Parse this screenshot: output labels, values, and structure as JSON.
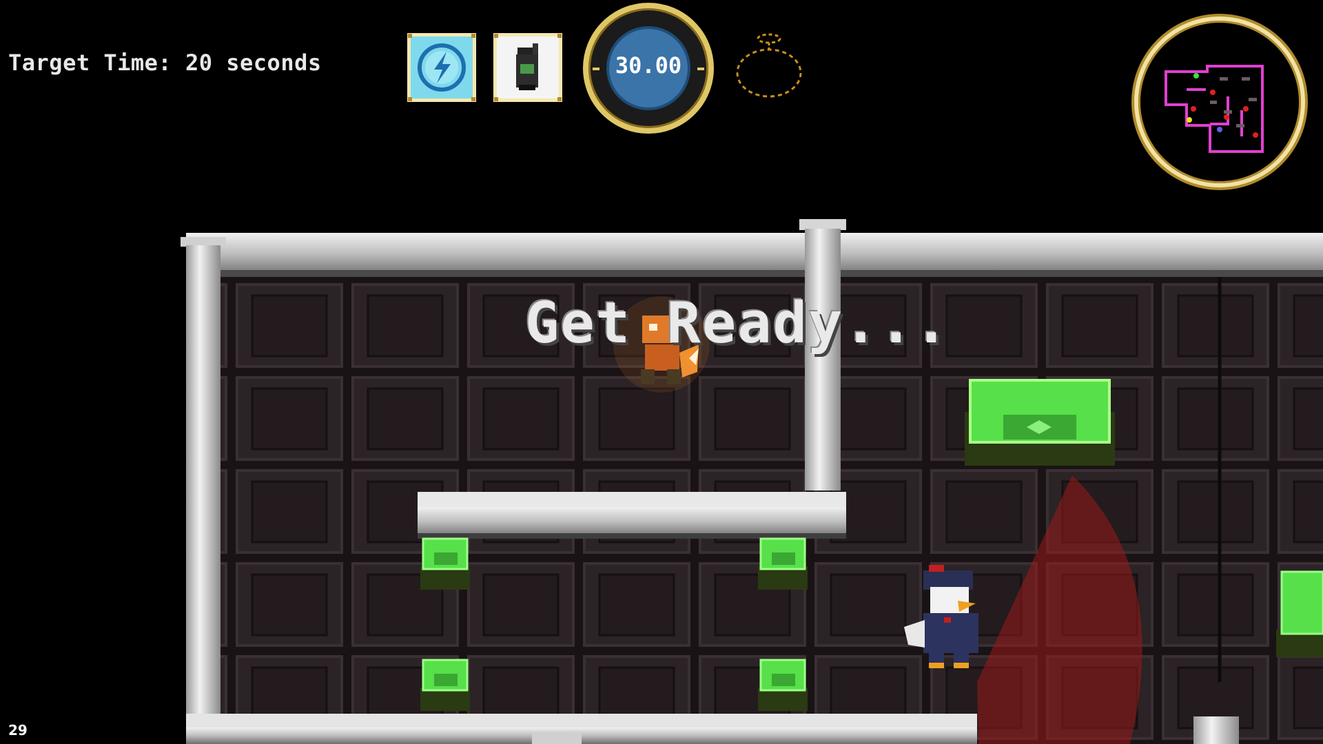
{
  "hud": {
    "target_time": "Target Time: 20 seconds",
    "timer": "30.00",
    "fps": "29",
    "abilities": [
      {
        "name": "lightning-ability",
        "icon": "lightning-icon",
        "color": "#7fd9ec"
      },
      {
        "name": "grenade-ability",
        "icon": "grenade-icon",
        "color": "#f4f4f4"
      }
    ],
    "loot_indicator_icon": "loot-bag-icon",
    "minimap_icon": "minimap-icon"
  },
  "overlay": {
    "message": "Get Ready..."
  },
  "colors": {
    "wall_panel": "#2a2224",
    "wall_panel_inner": "#1e1719",
    "rail": "#d9d9d9",
    "cash_green": "#57e04a",
    "vision_cone": "#9a1a1a",
    "minimap_walls": "#e040d0",
    "gold_ring": "#e0c766"
  },
  "entities": {
    "player": "fox-thief",
    "guard": "duck-police-guard",
    "loot": "cash-crate"
  }
}
